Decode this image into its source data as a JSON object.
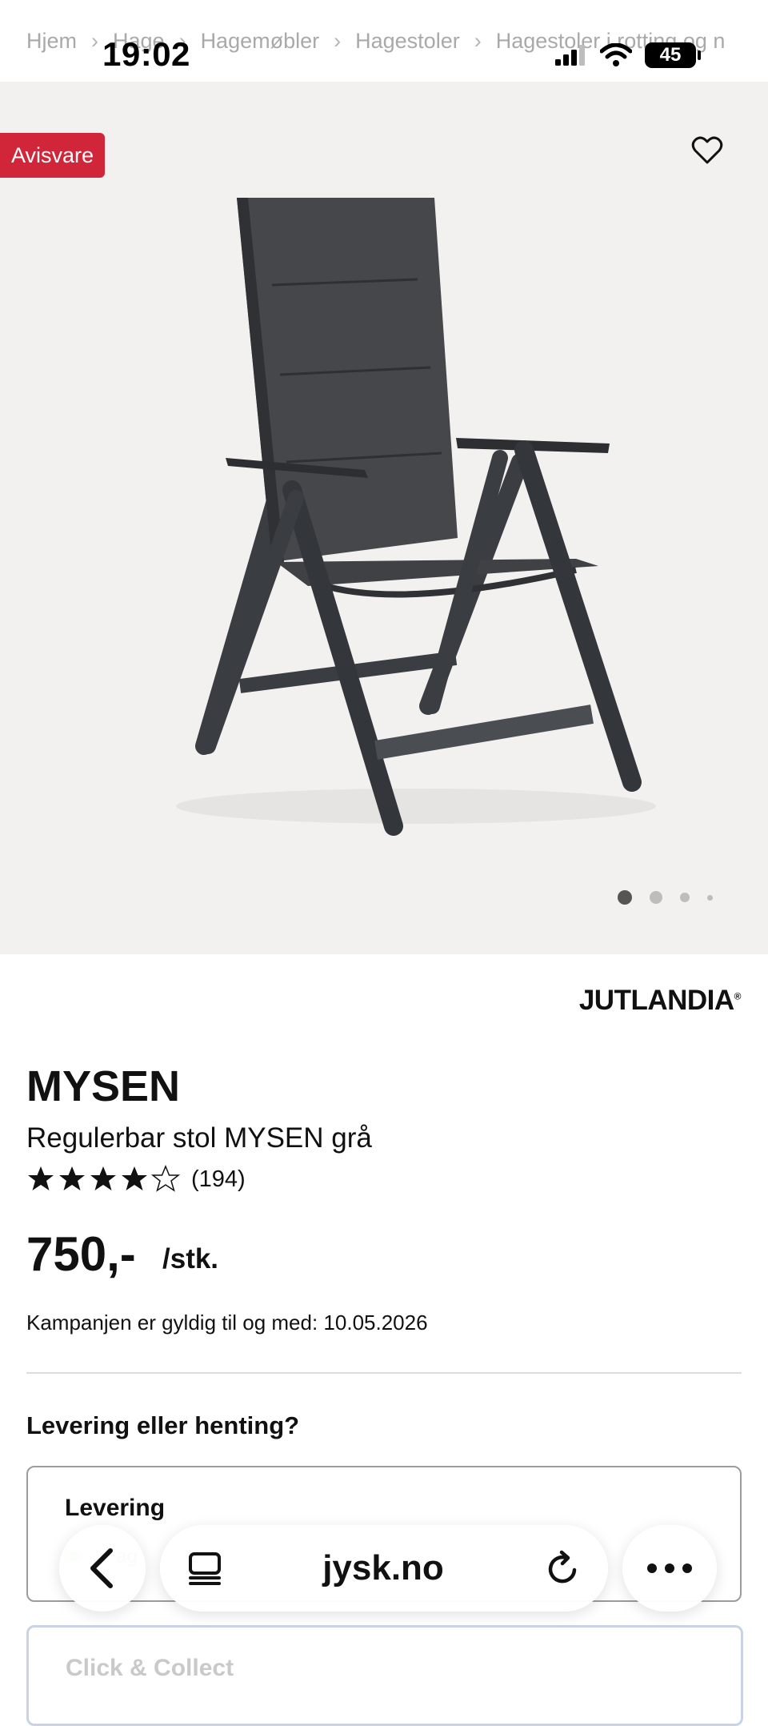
{
  "status_bar": {
    "time": "19:02",
    "battery": "45"
  },
  "breadcrumb": [
    "Hjem",
    "Hage",
    "Hagemøbler",
    "Hagestoler",
    "Hagestoler i rotting og n"
  ],
  "gallery": {
    "badge": "Avisvare",
    "image_count": 4,
    "active_index": 0
  },
  "product": {
    "brand": "JUTLANDIA",
    "brand_mark": "®",
    "title": "MYSEN",
    "subtitle": "Regulerbar stol MYSEN grå",
    "rating_value": 4.5,
    "rating_count": "(194)",
    "price": "750,-",
    "unit": "/stk.",
    "campaign": "Kampanjen er gyldig til og med: 10.05.2026"
  },
  "delivery": {
    "question": "Levering eller henting?",
    "option1_title": "Levering",
    "option1_sub": "ag",
    "option2_title": "Click & Collect"
  },
  "browser": {
    "url": "jysk.no"
  },
  "colors": {
    "badge": "#d1253a",
    "gallery_bg": "#f2f1f0"
  }
}
